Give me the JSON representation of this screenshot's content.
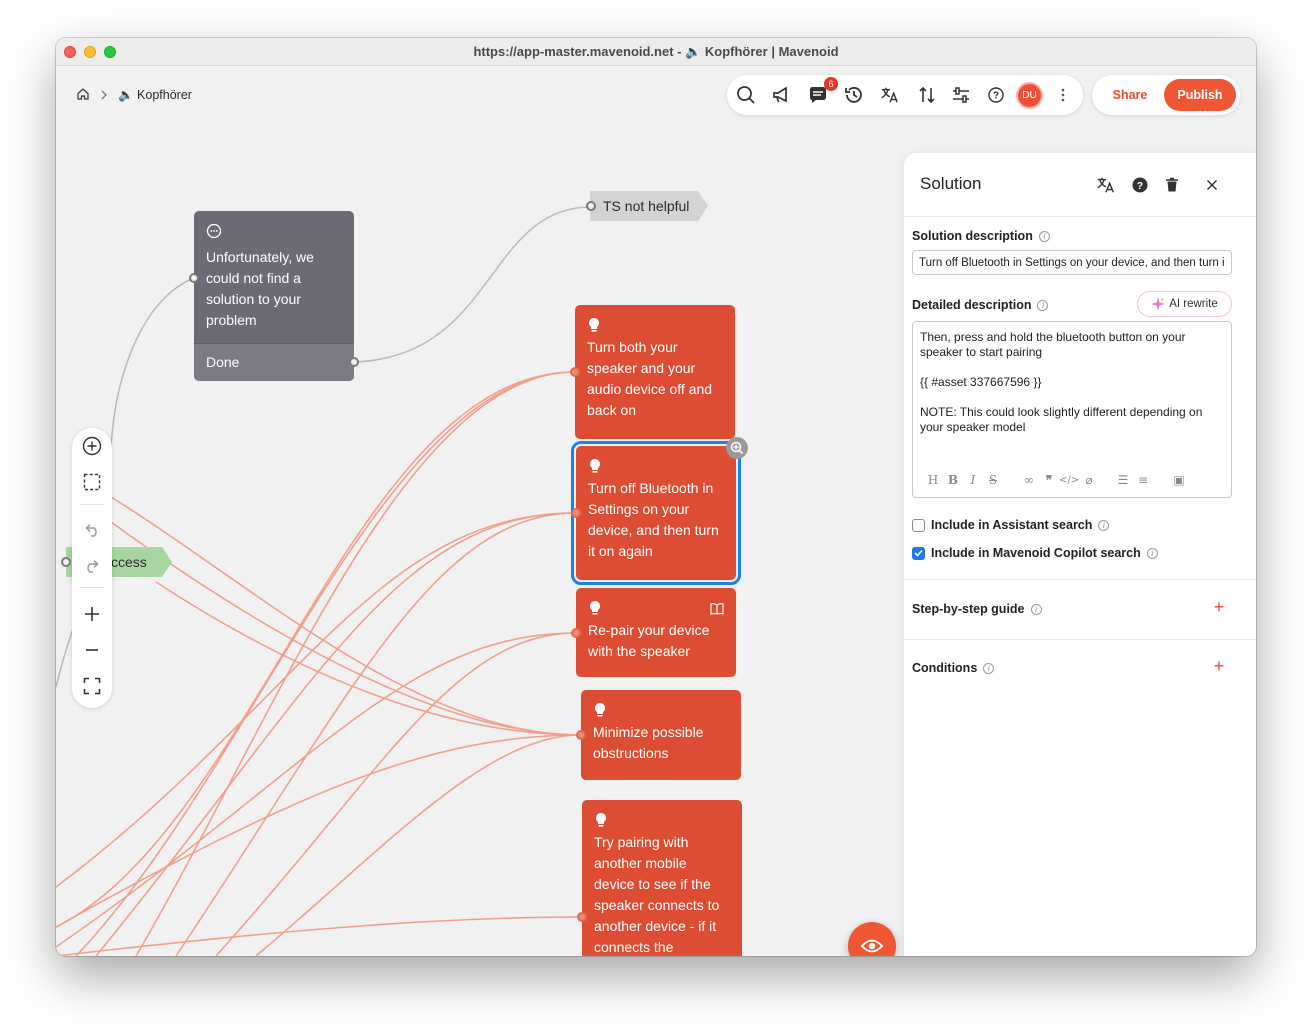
{
  "window": {
    "title": "https://app-master.mavenoid.net - 🔈 Kopfhörer | Mavenoid"
  },
  "breadcrumb": {
    "page": "🔈 Kopfhörer"
  },
  "toolbar": {
    "icons": [
      "search-icon",
      "megaphone-icon",
      "comments-icon",
      "history-icon",
      "translate-icon",
      "sort-icon",
      "sliders-icon",
      "help-icon",
      "more-icon"
    ],
    "notification_count": "6",
    "avatar_initials": "DU",
    "share_label": "Share",
    "publish_label": "Publish",
    "accent_color": "#ef5634"
  },
  "canvas": {
    "message_node": {
      "text": "Unfortunately, we could not find a solution to your problem",
      "done_label": "Done"
    },
    "ts_node": {
      "label": "TS not helpful"
    },
    "success_node": {
      "label": "ccess"
    },
    "solutions": [
      {
        "text": "Turn both your speaker and your audio device off and back on"
      },
      {
        "text": "Turn off Bluetooth in Settings on your device, and then turn it on again",
        "selected": true
      },
      {
        "text": "Re-pair your device with the speaker"
      },
      {
        "text": "Minimize possible obstructions"
      },
      {
        "text": "Try pairing with another mobile device to see if the speaker connects to another device - if it connects the"
      }
    ],
    "node_color": "#dd4d33",
    "edge_color": "#eea08f"
  },
  "left_toolbar": {
    "icons": [
      "add-node-icon",
      "select-area-icon",
      "undo-icon",
      "redo-icon",
      "zoom-in-icon",
      "zoom-out-icon",
      "fit-screen-icon"
    ]
  },
  "panel": {
    "title": "Solution",
    "solution_description_label": "Solution description",
    "solution_description_value": "Turn off Bluetooth in Settings on your device, and then turn it on again",
    "detailed_description_label": "Detailed description",
    "ai_rewrite_label": "AI rewrite",
    "detailed_description_text": "Then, press and hold the bluetooth button on your speaker to start pairing\n\n{{ #asset 337667596 }}\n\nNOTE: This could look slightly different depending on your speaker model",
    "include_assistant_label": "Include in Assistant search",
    "include_assistant_checked": false,
    "include_copilot_label": "Include in Mavenoid Copilot search",
    "include_copilot_checked": true,
    "step_guide_label": "Step-by-step guide",
    "conditions_label": "Conditions"
  }
}
